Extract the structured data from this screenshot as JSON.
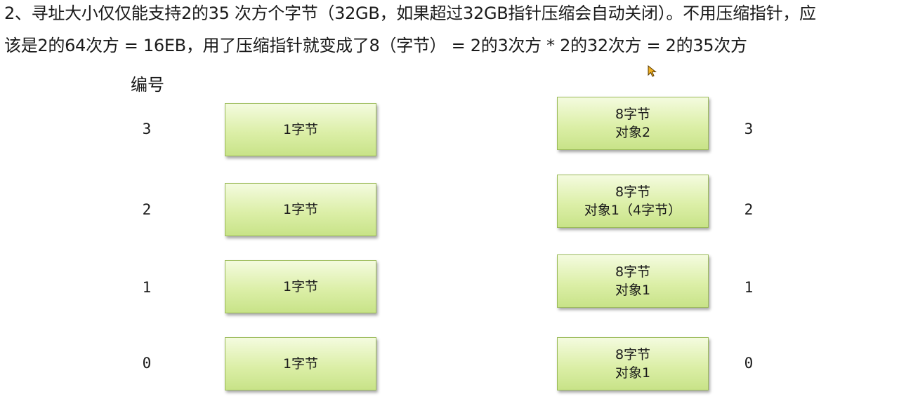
{
  "heading": {
    "line1": "2、寻址大小仅仅能支持2的35 次方个字节（32GB，如果超过32GB指针压缩会自动关闭）。不用压缩指针，应",
    "line2": "该是2的64次方 = 16EB，用了压缩指针就变成了8（字节）  = 2的3次方 * 2的32次方 = 2的35次方"
  },
  "column_header": "编号",
  "left_column": [
    {
      "index": "3",
      "label": "1字节"
    },
    {
      "index": "2",
      "label": "1字节"
    },
    {
      "index": "1",
      "label": "1字节"
    },
    {
      "index": "0",
      "label": "1字节"
    }
  ],
  "right_column": [
    {
      "index": "3",
      "line1": "8字节",
      "line2": "对象2"
    },
    {
      "index": "2",
      "line1": "8字节",
      "line2": "对象1（4字节）"
    },
    {
      "index": "1",
      "line1": "8字节",
      "line2": "对象1"
    },
    {
      "index": "0",
      "line1": "8字节",
      "line2": "对象1"
    }
  ],
  "colors": {
    "box_fill_top": "#f4fbdf",
    "box_fill_bottom": "#c8e388",
    "box_border": "#9bbb59"
  },
  "icons": [
    "mouse-cursor-icon"
  ]
}
